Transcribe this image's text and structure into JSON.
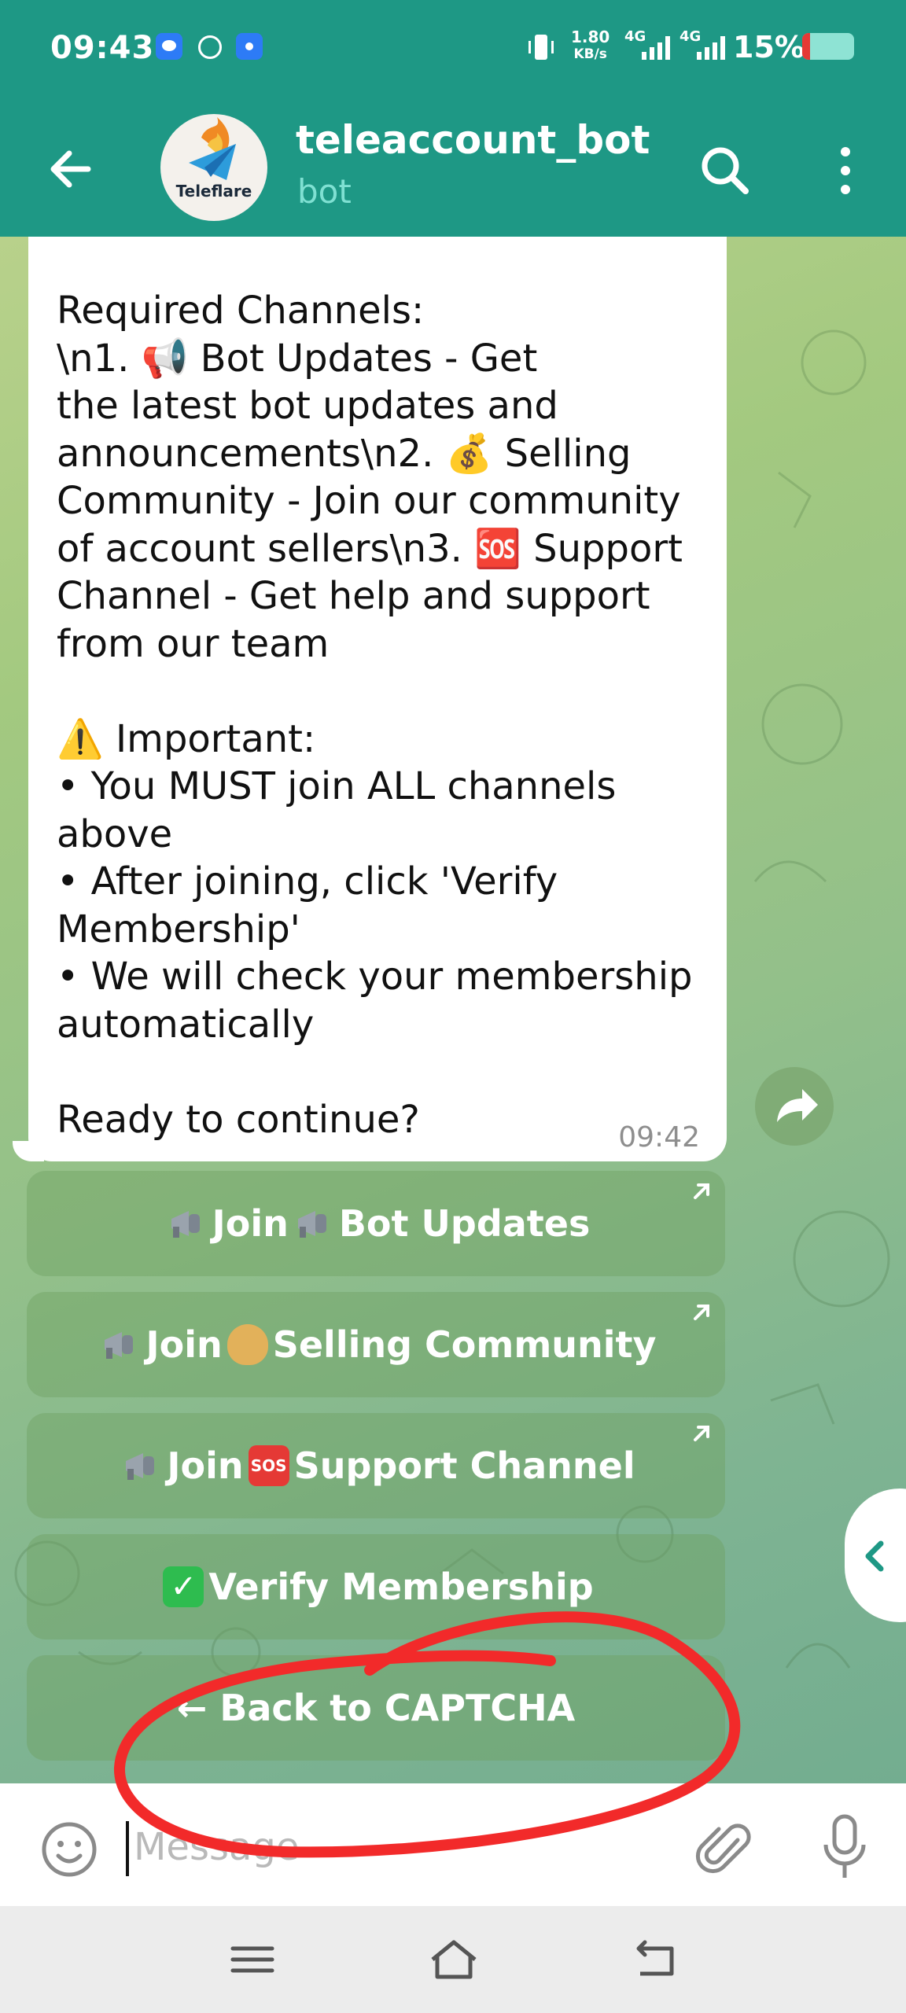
{
  "status_bar": {
    "time": "09:43",
    "net_speed_value": "1.80",
    "net_speed_unit": "KB/s",
    "sim1": "4G",
    "sim2": "4G",
    "battery_text": "15%",
    "battery_level": 0.15
  },
  "header": {
    "title": "teleaccount_bot",
    "subtitle": "bot",
    "avatar_label": "Teleflare"
  },
  "message": {
    "text": "Required Channels:\n\\n1. 📢 Bot Updates - Get\nthe latest bot updates and\nannouncements\\n2. 💰 Selling\nCommunity - Join our community\nof account sellers\\n3. 🆘 Support\nChannel - Get help and support\nfrom our team\n\n⚠️ Important:\n• You MUST join ALL channels\nabove\n• After joining, click 'Verify\nMembership'\n• We will check your membership\nautomatically\n\nReady to continue?",
    "time": "09:42"
  },
  "keyboard": {
    "btn1_pre": "Join",
    "btn1_post": "Bot Updates",
    "btn2_pre": "Join",
    "btn2_post": "Selling Community",
    "btn3_pre": "Join",
    "btn3_post": "Support Channel",
    "btn4": "Verify Membership",
    "btn5": "← Back to CAPTCHA"
  },
  "input": {
    "placeholder": "Message"
  },
  "colors": {
    "header": "#1e9885",
    "annotation": "#f22a2a"
  }
}
